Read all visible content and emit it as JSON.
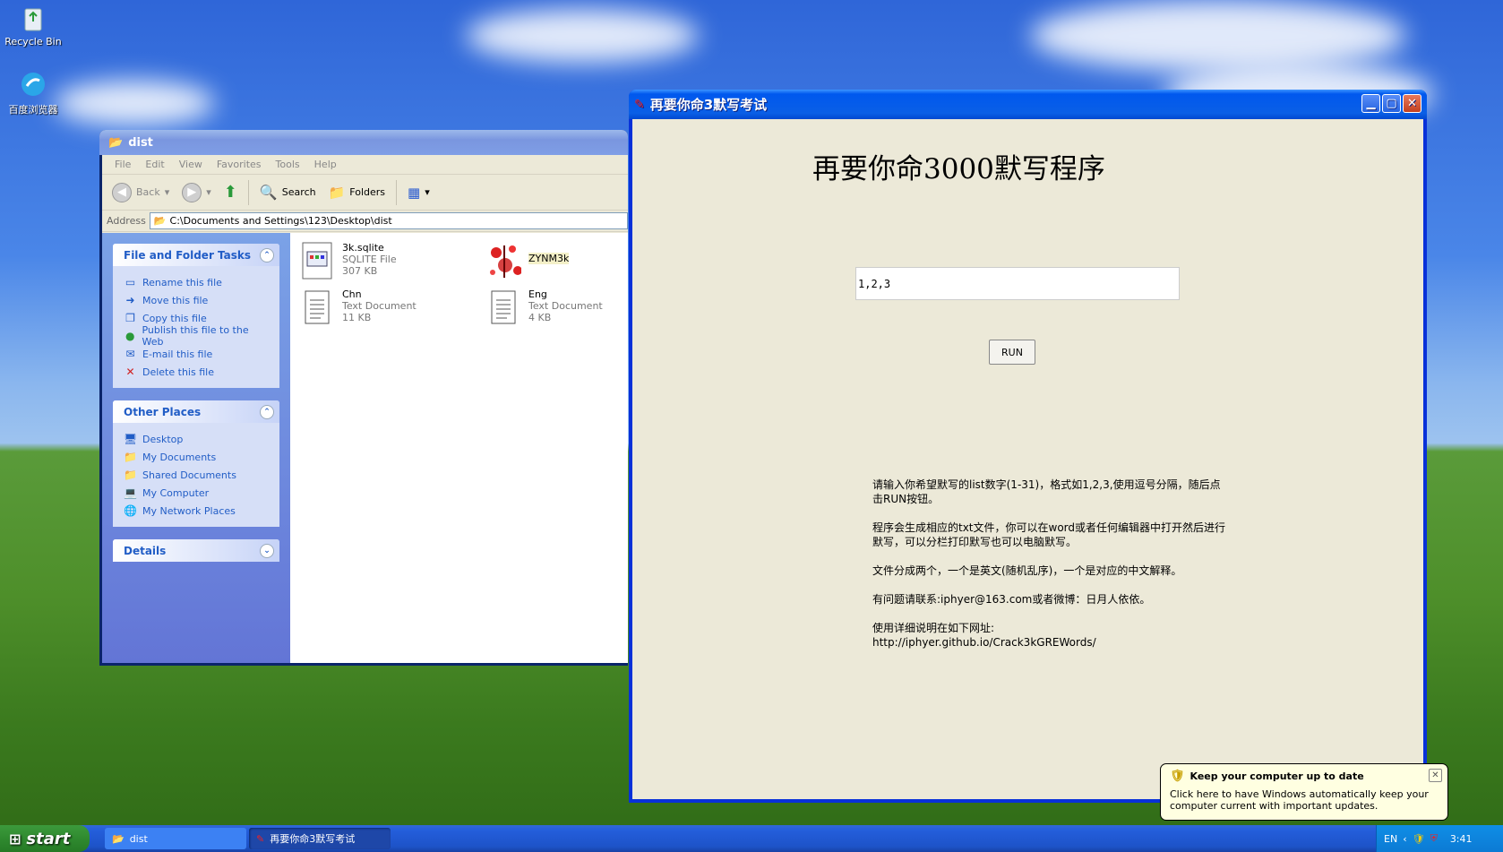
{
  "desktop": {
    "icons": [
      {
        "label": "Recycle Bin"
      },
      {
        "label": "百度浏览器"
      }
    ]
  },
  "explorer": {
    "title": "dist",
    "menu": [
      "File",
      "Edit",
      "View",
      "Favorites",
      "Tools",
      "Help"
    ],
    "toolbar": {
      "back": "Back",
      "search": "Search",
      "folders": "Folders"
    },
    "address_label": "Address",
    "address": "C:\\Documents and Settings\\123\\Desktop\\dist",
    "file_tasks": {
      "title": "File and Folder Tasks",
      "items": [
        "Rename this file",
        "Move this file",
        "Copy this file",
        "Publish this file to the Web",
        "E-mail this file",
        "Delete this file"
      ]
    },
    "other_places": {
      "title": "Other Places",
      "items": [
        "Desktop",
        "My Documents",
        "Shared Documents",
        "My Computer",
        "My Network Places"
      ]
    },
    "details": {
      "title": "Details"
    },
    "files": [
      {
        "name": "3k.sqlite",
        "type": "SQLITE File",
        "size": "307 KB"
      },
      {
        "name": "ZYNM3k",
        "type": "",
        "size": ""
      },
      {
        "name": "Chn",
        "type": "Text Document",
        "size": "11 KB"
      },
      {
        "name": "Eng",
        "type": "Text Document",
        "size": "4 KB"
      }
    ]
  },
  "app": {
    "title": "再要你命3默写考试",
    "heading": "再要你命3000默写程序",
    "input_value": "1,2,3",
    "run_label": "RUN",
    "instructions": [
      "请输入你希望默写的list数字(1-31)，格式如1,2,3,使用逗号分隔，随后点击RUN按钮。",
      "程序会生成相应的txt文件，你可以在word或者任何编辑器中打开然后进行默写，可以分栏打印默写也可以电脑默写。",
      "文件分成两个，一个是英文(随机乱序)，一个是对应的中文解释。",
      "有问题请联系:iphyer@163.com或者微博：日月人依依。",
      "使用详细说明在如下网址:\nhttp://iphyer.github.io/Crack3kGREWords/"
    ]
  },
  "taskbar": {
    "start": "start",
    "tasks": [
      {
        "label": "dist"
      },
      {
        "label": "再要你命3默写考试"
      }
    ],
    "lang": "EN",
    "clock": "3:41"
  },
  "balloon": {
    "title": "Keep your computer up to date",
    "text": "Click here to have Windows automatically keep your computer current with important updates."
  }
}
